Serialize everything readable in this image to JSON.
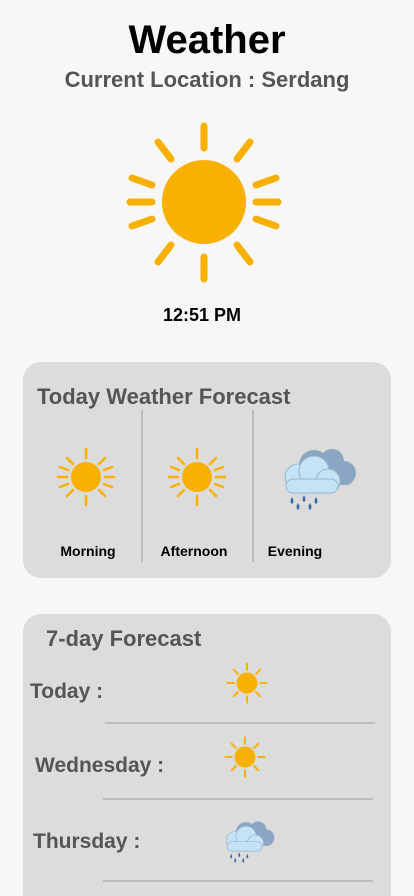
{
  "app": {
    "title": "Weather",
    "location": "Current Location : Serdang",
    "time": "12:51 PM",
    "current_icon": "sun-icon"
  },
  "today_forecast": {
    "title": "Today Weather Forecast",
    "periods": [
      {
        "label": "Morning",
        "icon": "sun-icon"
      },
      {
        "label": "Afternoon",
        "icon": "sun-icon"
      },
      {
        "label": "Evening",
        "icon": "rain-cloud-icon"
      }
    ]
  },
  "week_forecast": {
    "title": "7-day Forecast",
    "days": [
      {
        "label": "Today :",
        "icon": "sun-icon"
      },
      {
        "label": "Wednesday :",
        "icon": "sun-icon"
      },
      {
        "label": "Thursday :",
        "icon": "rain-cloud-icon"
      }
    ]
  },
  "colors": {
    "sun": "#f9b000",
    "cloud_light": "#c4e3f5",
    "cloud_dark": "#8aa6c2",
    "rain": "#3b6ea5",
    "card": "#dcdcdc"
  }
}
